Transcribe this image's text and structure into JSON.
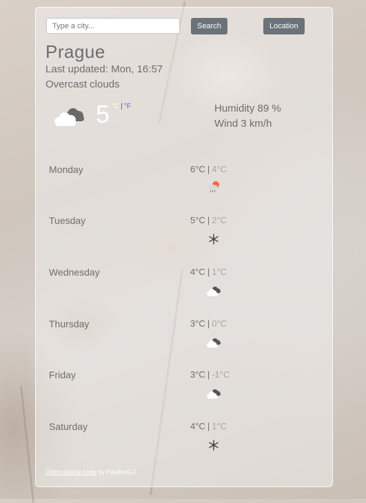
{
  "search": {
    "placeholder": "Type a city...",
    "value": ""
  },
  "buttons": {
    "search_label": "Search",
    "location_label": "Location"
  },
  "current": {
    "city": "Prague",
    "last_updated": "Last updated: Mon, 16:57",
    "description": "Overcast clouds",
    "temperature": "5",
    "unit_c": "°C",
    "unit_sep": "|",
    "unit_f": "°F",
    "icon": "overcast-clouds-icon",
    "humidity": "Humidity 89 %",
    "wind": "Wind 3 km/h"
  },
  "forecast": [
    {
      "day": "Monday",
      "max": "6°C",
      "min": "4°C",
      "icon": "sun-cloud-rain-icon"
    },
    {
      "day": "Tuesday",
      "max": "5°C",
      "min": "2°C",
      "icon": "snowflake-icon"
    },
    {
      "day": "Wednesday",
      "max": "4°C",
      "min": "1°C",
      "icon": "overcast-clouds-icon"
    },
    {
      "day": "Thursday",
      "max": "3°C",
      "min": "0°C",
      "icon": "overcast-clouds-icon"
    },
    {
      "day": "Friday",
      "max": "3°C",
      "min": "-1°C",
      "icon": "overcast-clouds-icon"
    },
    {
      "day": "Saturday",
      "max": "4°C",
      "min": "1°C",
      "icon": "snowflake-icon"
    }
  ],
  "footer": {
    "link_text": "Open-source code",
    "rest_text": " by PaulinaGJ"
  },
  "colors": {
    "button_bg": "#6b7279",
    "accent_f": "#3c6fd6",
    "text": "#6d6d6d"
  }
}
